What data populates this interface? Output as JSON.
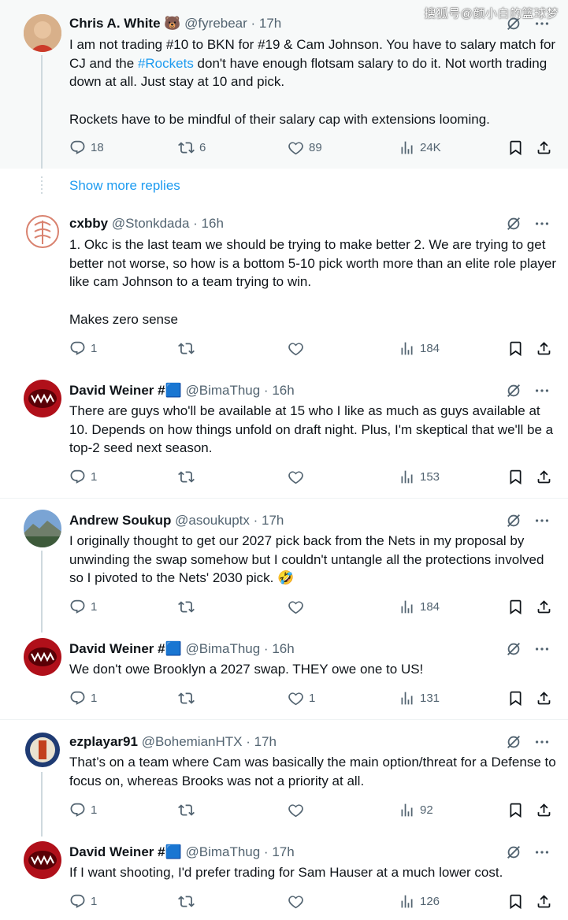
{
  "watermark": "搜狐号@颜小白的篮球梦",
  "show_more": "Show more replies",
  "tweets": [
    {
      "name": "Chris A. White 🐻",
      "handle": "@fyrebear · 17h",
      "text_a": "I am not trading #10 to BKN for #19 & Cam Johnson. You have to salary match for CJ and the ",
      "hashtag": "#Rockets",
      "text_b": " don't have enough flotsam salary to do it. Not worth trading down at all. Just stay at 10 and pick.\n\nRockets have to be mindful of their salary cap with extensions looming.",
      "replies": "18",
      "reposts": "6",
      "likes": "89",
      "views": "24K"
    },
    {
      "name": "cxbby",
      "handle": "@Stonkdada · 16h",
      "text": "1. Okc is the last team we should be trying to make better 2. We are trying to get better not worse, so how is a bottom 5-10 pick worth more than an elite role player like cam Johnson to a team trying to win.\n\nMakes zero sense",
      "replies": "1",
      "reposts": "",
      "likes": "",
      "views": "184"
    },
    {
      "name": "David Weiner #🟦",
      "handle": "@BimaThug · 16h",
      "text": "There are guys who'll be available at 15 who I like as much as guys available at 10. Depends on how things unfold on draft night. Plus, I'm skeptical that we'll be a top-2 seed next season.",
      "replies": "1",
      "reposts": "",
      "likes": "",
      "views": "153"
    },
    {
      "name": "Andrew Soukup",
      "handle": "@asoukuptx · 17h",
      "text": "I originally thought to get our 2027 pick back from the Nets in my proposal by unwinding the swap somehow but I couldn't untangle all the protections involved so I pivoted to the Nets' 2030 pick. 🤣",
      "replies": "1",
      "reposts": "",
      "likes": "",
      "views": "184"
    },
    {
      "name": "David Weiner #🟦",
      "handle": "@BimaThug · 16h",
      "text": "We don't owe Brooklyn a 2027 swap. THEY owe one to US!",
      "replies": "1",
      "reposts": "",
      "likes": "1",
      "views": "131"
    },
    {
      "name": "ezplayar91",
      "handle": "@BohemianHTX · 17h",
      "text": "That’s on a team where Cam was basically the main option/threat for a Defense to focus on, whereas Brooks was not a priority at all.",
      "replies": "1",
      "reposts": "",
      "likes": "",
      "views": "92"
    },
    {
      "name": "David Weiner #🟦",
      "handle": "@BimaThug · 17h",
      "text": "If I want shooting, I'd prefer trading for Sam Hauser at a much lower cost.",
      "replies": "1",
      "reposts": "",
      "likes": "",
      "views": "126"
    }
  ]
}
